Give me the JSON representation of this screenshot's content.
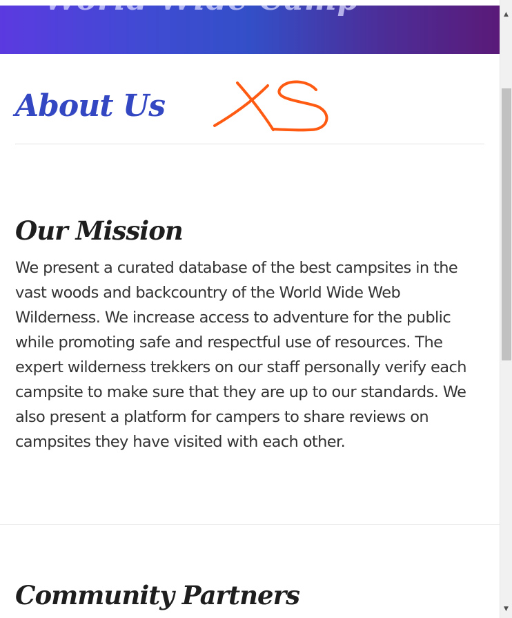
{
  "hero": {
    "title": "World Wide Camp"
  },
  "about": {
    "heading": "About Us"
  },
  "annotation": {
    "text": "XS",
    "color": "#ff5a12"
  },
  "mission": {
    "heading": "Our Mission",
    "body": "We present a curated database of the best campsites in the vast woods and backcountry of the World Wide Web Wilderness. We increase access to adventure for the public while promoting safe and respectful use of resources. The expert wilderness trekkers on our staff personally verify each campsite to make sure that they are up to our standards. We also present a platform for campers to share reviews on campsites they have visited with each other."
  },
  "partners": {
    "heading": "Community Partners"
  },
  "scrollbar": {
    "up_icon": "arrow-up-icon",
    "down_icon": "arrow-down-icon"
  },
  "colors": {
    "accent": "#3347c3",
    "gradient_start": "#5b3ae0",
    "gradient_end": "#5a1a78"
  }
}
